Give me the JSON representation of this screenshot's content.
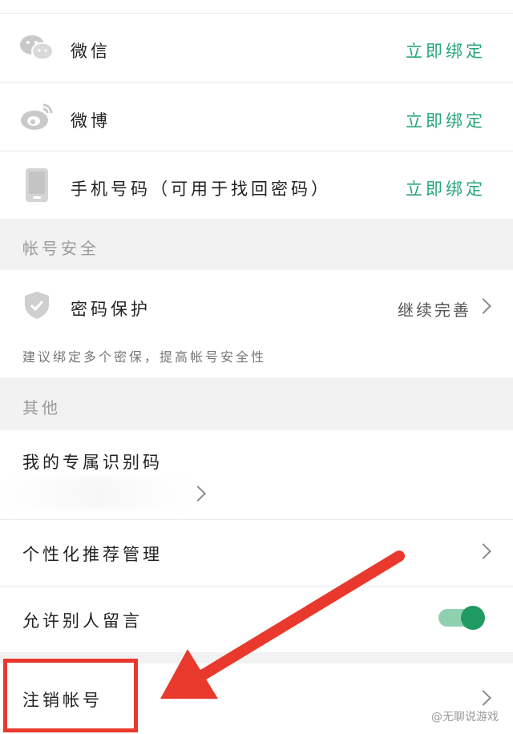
{
  "bind_rows": [
    {
      "label": "微信",
      "icon": "wechat-icon",
      "action": "立即绑定"
    },
    {
      "label": "微博",
      "icon": "weibo-icon",
      "action": "立即绑定"
    },
    {
      "label": "手机号码（可用于找回密码）",
      "icon": "phone-icon",
      "action": "立即绑定"
    }
  ],
  "security": {
    "section_title": "帐号安全",
    "password_protection": {
      "label": "密码保护",
      "icon": "shield-icon",
      "status": "继续完善"
    },
    "hint": "建议绑定多个密保，提高帐号安全性"
  },
  "other": {
    "section_title": "其他",
    "exclusive_id": {
      "label": "我的专属识别码"
    },
    "personalized_recommendation": {
      "label": "个性化推荐管理"
    },
    "allow_messages": {
      "label": "允许别人留言",
      "enabled": true
    },
    "deactivate": {
      "label": "注销帐号"
    }
  },
  "annotation": {
    "color": "#e8392c"
  },
  "watermark": "@无聊说游戏",
  "colors": {
    "accent": "#27a67a",
    "toggle": "#1f9a62",
    "annotation": "#e8392c"
  }
}
